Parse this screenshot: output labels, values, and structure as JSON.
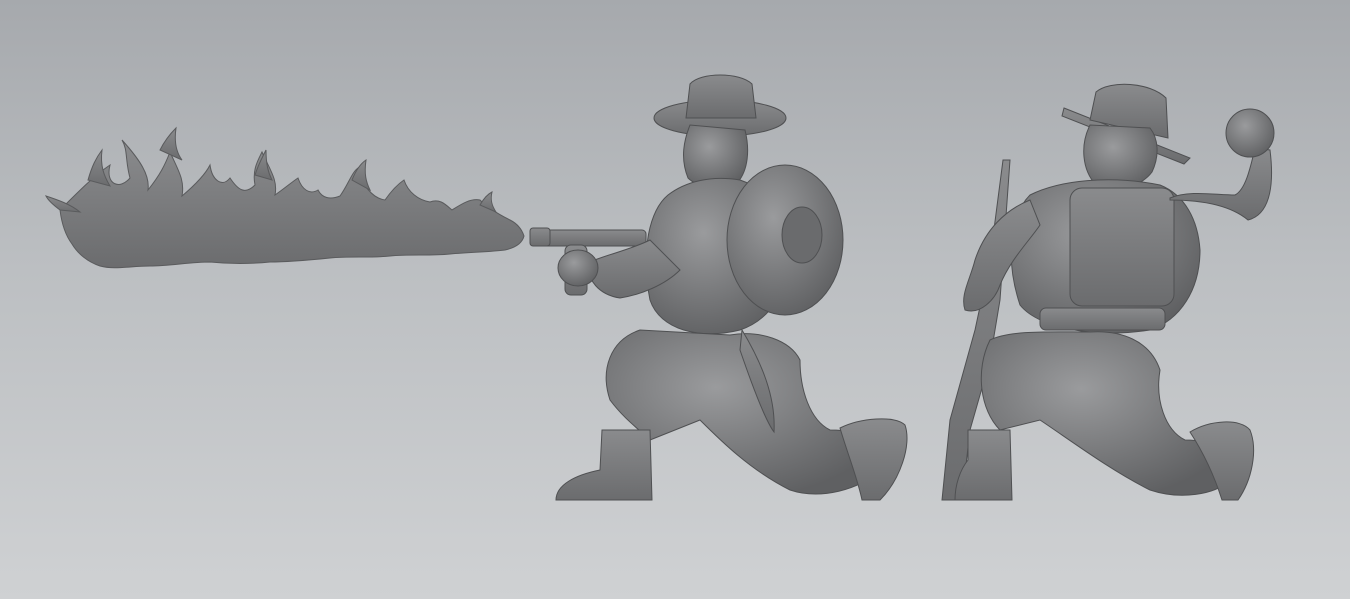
{
  "viewport": {
    "background_top": "#a6a9ad",
    "background_bottom": "#cfd1d3"
  },
  "render": {
    "material_color": "#7a7b7d",
    "shadow_color": "#55575a",
    "highlight_color": "#9c9ea0"
  },
  "figures": [
    {
      "name": "flamethrower-soldier",
      "description_visible": false
    },
    {
      "name": "grenade-soldier",
      "description_visible": false
    }
  ]
}
